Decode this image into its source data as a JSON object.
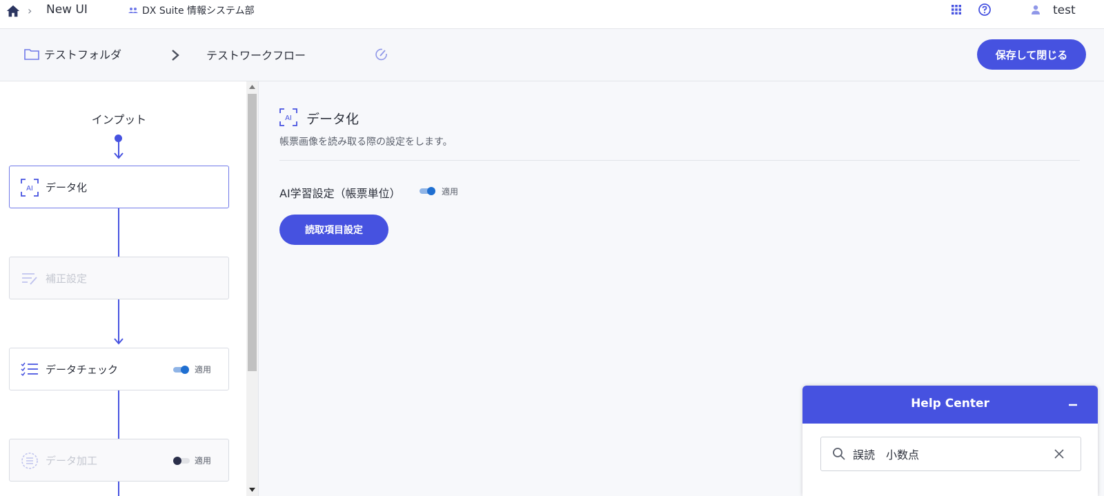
{
  "topbar": {
    "app_name": "New UI",
    "org_name": "DX Suite 情報システム部",
    "user_name": "test"
  },
  "breadcrumb": {
    "folder": "テストフォルダ",
    "workflow": "テストワークフロー",
    "save_close_label": "保存して閉じる"
  },
  "flow": {
    "input_label": "インプット",
    "nodes": [
      {
        "label": "データ化",
        "icon": "ai-scan-icon",
        "state": "active"
      },
      {
        "label": "補正設定",
        "icon": "list-edit-icon",
        "state": "disabled"
      },
      {
        "label": "データチェック",
        "icon": "checklist-icon",
        "state": "enabled",
        "toggle_on": true,
        "toggle_label": "適用"
      },
      {
        "label": "データ加工",
        "icon": "list-process-icon",
        "state": "disabled",
        "toggle_on": false,
        "toggle_label": "適用"
      }
    ]
  },
  "settings": {
    "title": "データ化",
    "description": "帳票画像を読み取る際の設定をします。",
    "ai_learning_label": "AI学習設定（帳票単位）",
    "ai_learning_toggle_on": true,
    "ai_learning_toggle_label": "適用",
    "read_items_label": "読取項目設定"
  },
  "help_center": {
    "title": "Help Center",
    "search_value": "誤読　小数点"
  },
  "colors": {
    "accent": "#4652e0",
    "toggle_on": "#1f6fd1",
    "toggle_off_knob": "#2b2f4a"
  }
}
